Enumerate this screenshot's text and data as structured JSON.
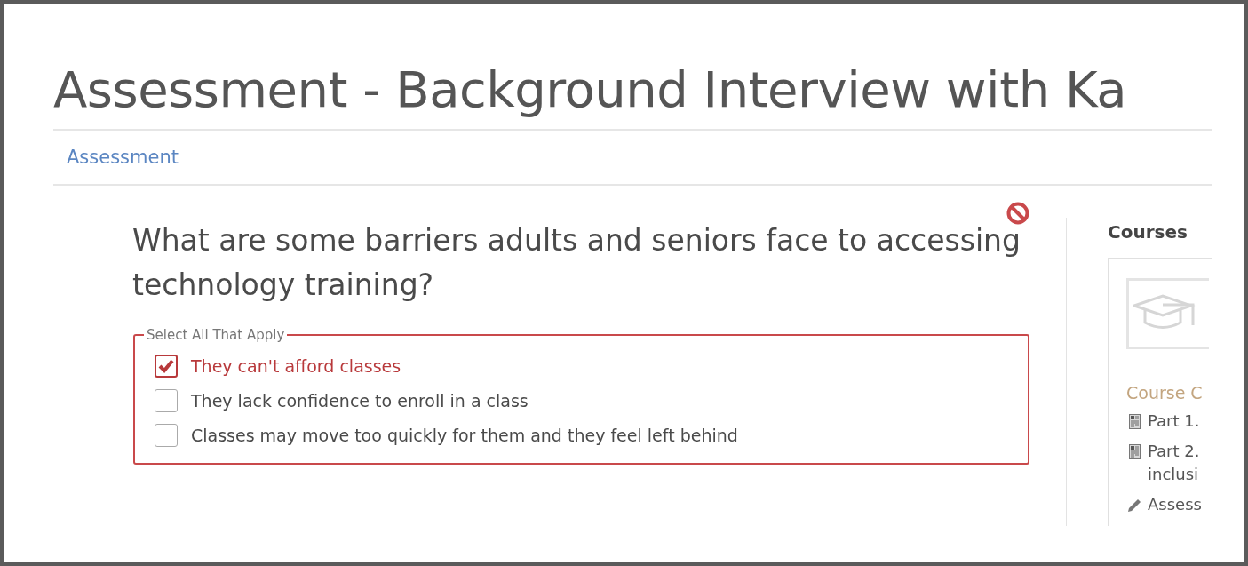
{
  "page": {
    "title": "Assessment - Background Interview with Ka"
  },
  "breadcrumb": {
    "label": "Assessment"
  },
  "question": {
    "text": "What are some barriers adults and seniors face to accessing technology training?",
    "invalid": true,
    "legend": "Select All That Apply",
    "options": [
      {
        "label": "They can't afford classes",
        "checked": true
      },
      {
        "label": "They lack confidence to enroll in a class",
        "checked": false
      },
      {
        "label": "Classes may move too quickly for them and they feel left behind",
        "checked": false
      }
    ]
  },
  "sidebar": {
    "heading": "Courses",
    "section": "Course C",
    "items": [
      {
        "kind": "page",
        "lines": [
          "Part 1."
        ]
      },
      {
        "kind": "page",
        "lines": [
          "Part 2.",
          "inclusi"
        ]
      },
      {
        "kind": "assessment",
        "lines": [
          "Assess"
        ]
      }
    ]
  }
}
